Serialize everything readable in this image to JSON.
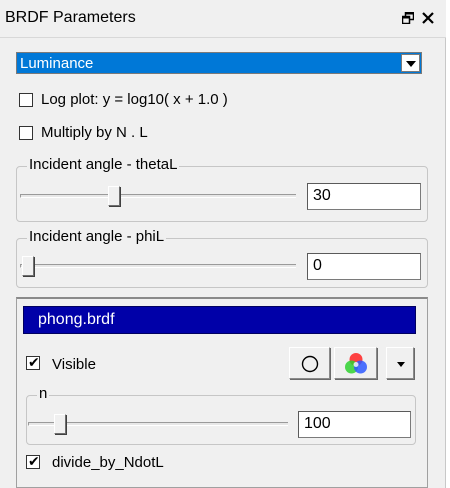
{
  "window": {
    "title": "BRDF Parameters",
    "restore_icon": "restore-window-icon",
    "close_icon": "close-icon"
  },
  "channel_select": {
    "value": "Luminance",
    "arrow_icon": "chevron-down-icon",
    "highlight_color": "#0078d7"
  },
  "options": {
    "log_plot": {
      "label": "Log plot:  y = log10( x + 1.0 )",
      "checked": false
    },
    "multiply": {
      "label": "Multiply by N . L",
      "checked": false
    }
  },
  "theta": {
    "label": "Incident angle - thetaL",
    "value": "30",
    "slider_fraction": 0.33
  },
  "phi": {
    "label": "Incident angle - phiL",
    "value": "0",
    "slider_fraction": 0.0
  },
  "brdf": {
    "name": "phong.brdf",
    "name_bar_color": "#0000a8",
    "visible": {
      "label": "Visible",
      "checked": true
    },
    "buttons": {
      "shape_icon": "circle-icon",
      "color_icon": "color-wheel-icon",
      "menu_icon": "chevron-down-icon"
    },
    "param": {
      "label": "n",
      "value": "100",
      "slider_fraction": 0.1
    },
    "divide": {
      "label": "divide_by_NdotL",
      "checked": true
    }
  }
}
